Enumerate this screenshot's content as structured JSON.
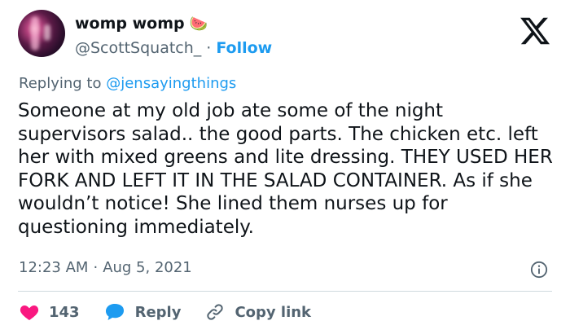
{
  "author": {
    "display_name": "womp womp",
    "emoji": "🍉",
    "handle": "@ScottSquatch_",
    "separator": "·",
    "follow_label": "Follow"
  },
  "reply_context": {
    "prefix": "Replying to",
    "mention": "@jensayingthings"
  },
  "tweet": {
    "text": "Someone at my old job ate some of the night supervisors salad.. the good parts. The chicken etc. left her with mixed greens and lite dressing. THEY USED HER FORK AND LEFT IT IN THE SALAD CONTAINER. As if she wouldn’t notice! She lined them nurses up for questioning immediately."
  },
  "meta": {
    "time": "12:23 AM",
    "separator": "·",
    "date": "Aug 5, 2021"
  },
  "actions": {
    "likes_count": "143",
    "reply_label": "Reply",
    "copy_link_label": "Copy link"
  },
  "icons": {
    "logo": "x-logo-icon",
    "info": "info-icon",
    "like": "heart-icon",
    "reply": "speech-bubble-icon",
    "copy": "link-icon"
  },
  "colors": {
    "accent": "#1d9bf0",
    "like": "#f91880",
    "text": "#0f1419",
    "secondary": "#536471"
  }
}
